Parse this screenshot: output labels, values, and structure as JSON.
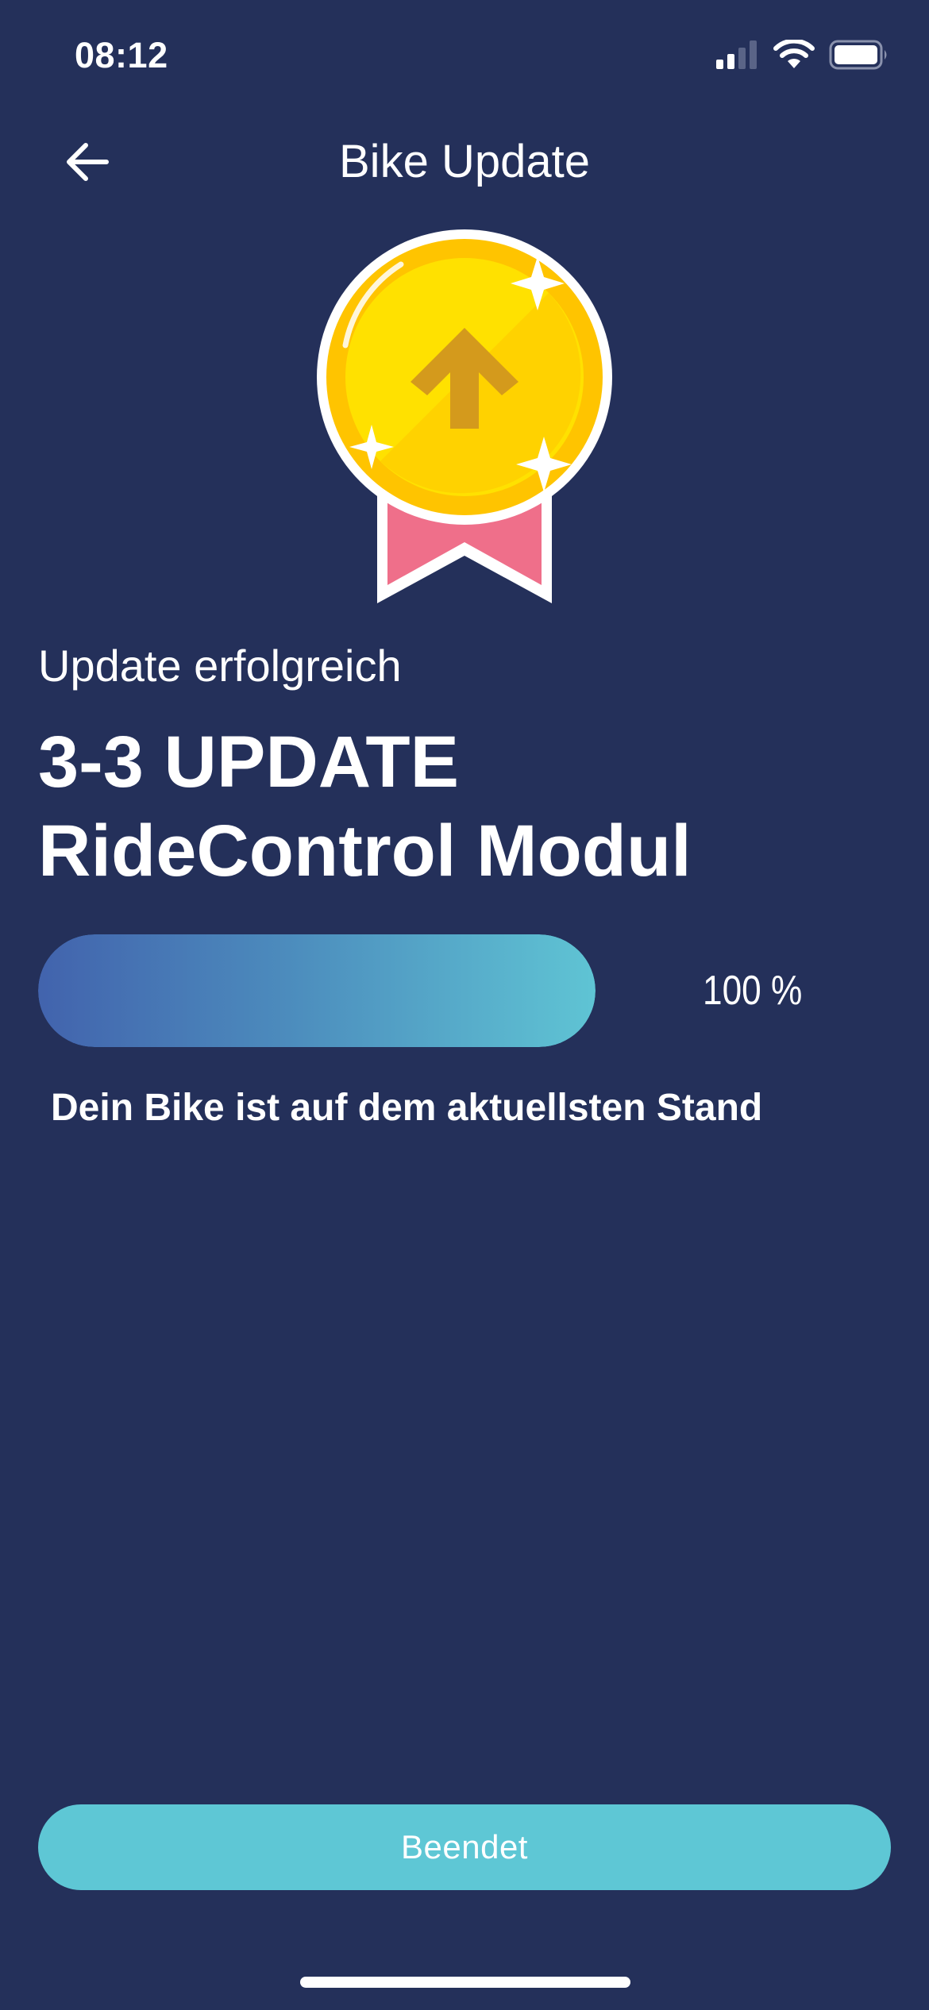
{
  "status_bar": {
    "time": "08:12",
    "signal_icon": "cellular-signal-icon",
    "wifi_icon": "wifi-icon",
    "battery_icon": "battery-icon"
  },
  "header": {
    "back_icon": "arrow-left-icon",
    "title": "Bike Update"
  },
  "medal": {
    "icon": "upload-medal-icon",
    "colors": {
      "gold": "#ffd600",
      "ribbon": "#ef6f8a",
      "arrow": "#d49a1c"
    }
  },
  "content": {
    "status_label": "Update erfolgreich",
    "title_line1": "3-3 UPDATE",
    "title_line2": "RideControl Modul",
    "progress_percent": 100,
    "progress_label": "100 %",
    "message": "Dein Bike ist auf dem aktuellsten Stand"
  },
  "footer": {
    "finish_label": "Beendet"
  },
  "colors": {
    "background": "#24305a",
    "accent": "#5ec7d5",
    "progress_start": "#4263ad",
    "progress_end": "#5fc4d4"
  }
}
